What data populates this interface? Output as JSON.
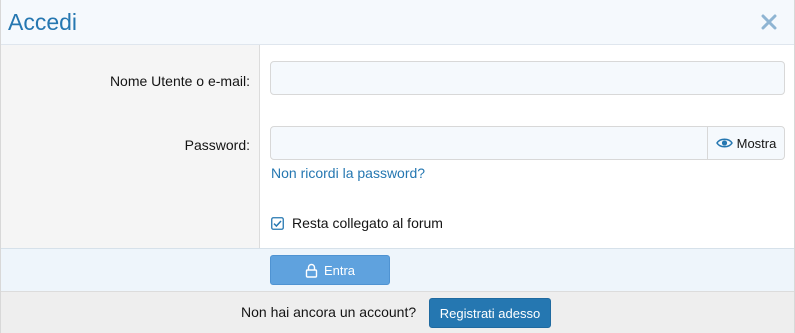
{
  "dialog": {
    "title": "Accedi",
    "close_icon": "close-icon"
  },
  "form": {
    "username_label": "Nome Utente o e-mail:",
    "username_value": "",
    "password_label": "Password:",
    "password_value": "",
    "show_password_label": "Mostra",
    "show_password_icon": "eye-icon",
    "forgot_password_link": "Non ricordi la password?",
    "remember_label": "Resta collegato al forum",
    "remember_checked": true
  },
  "actions": {
    "login_label": "Entra",
    "login_icon": "lock-icon"
  },
  "footer": {
    "prompt": "Non hai ancora un account?",
    "register_label": "Registrati adesso"
  },
  "colors": {
    "accent": "#2577b1",
    "primary_button": "#5fa2de",
    "header_bg": "#f5f9fd",
    "label_col_bg": "#f5f5f5",
    "footer_bg": "#eeeeee"
  }
}
